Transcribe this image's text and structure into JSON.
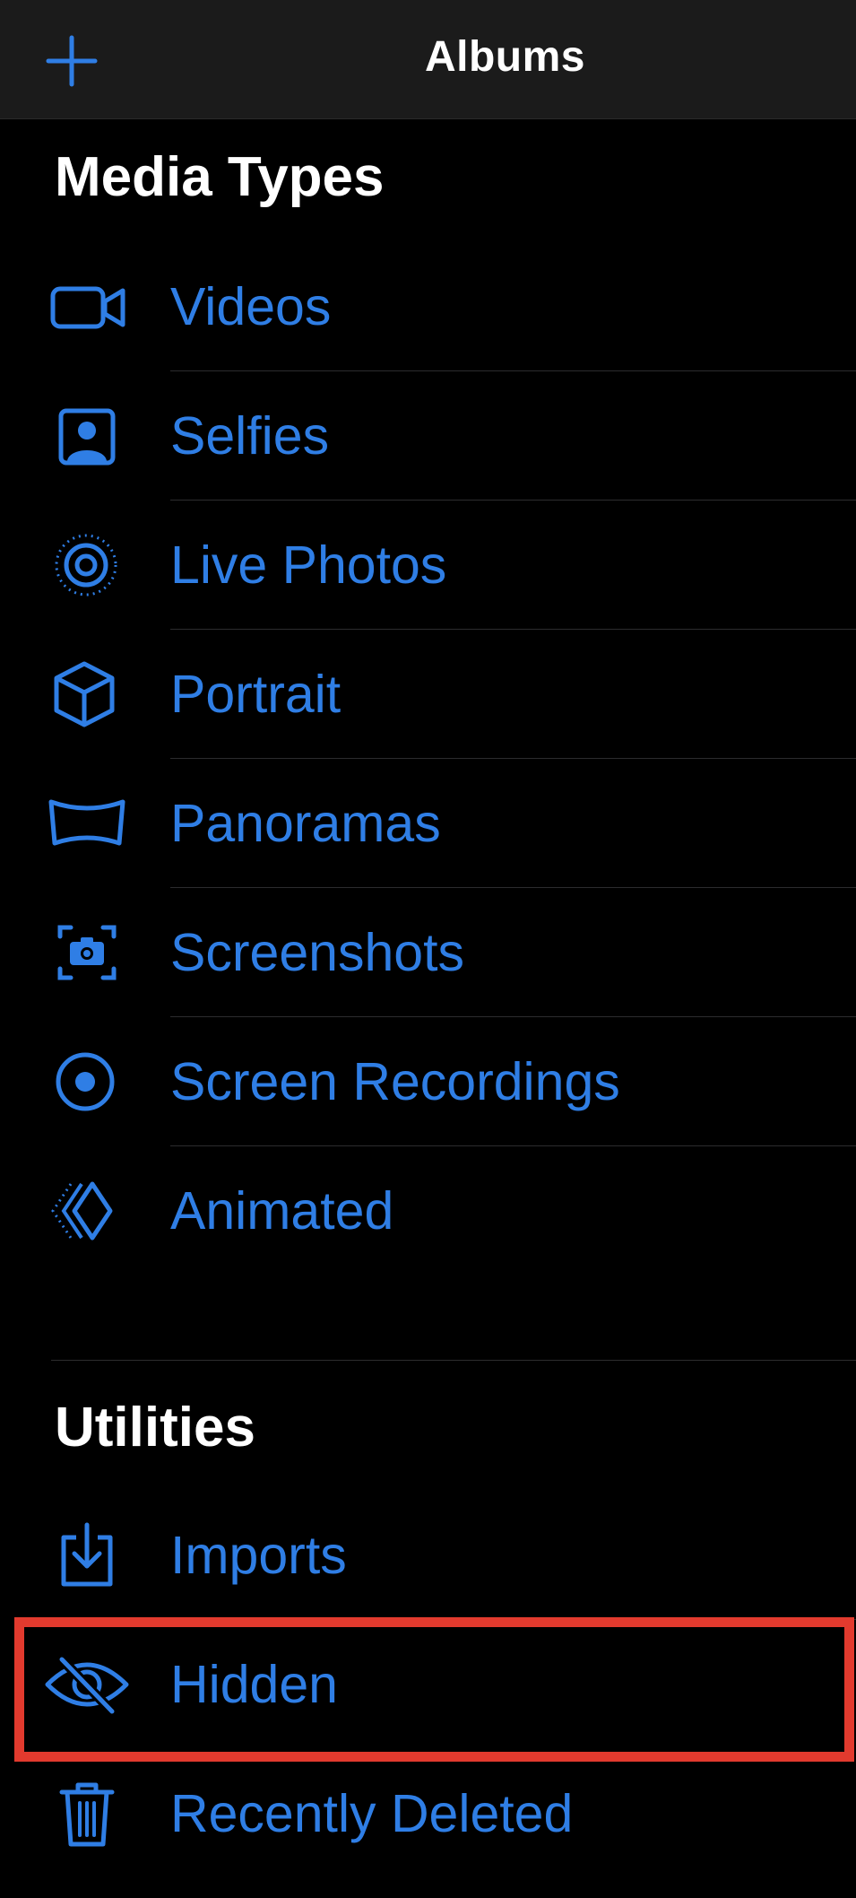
{
  "navbar": {
    "title": "Albums",
    "add_icon": "plus-icon"
  },
  "accent_color": "#2f7ee5",
  "highlight_color": "#e23a2e",
  "media_types": {
    "title": "Media Types",
    "items": [
      {
        "label": "Videos",
        "icon": "video-camera-icon"
      },
      {
        "label": "Selfies",
        "icon": "selfie-portrait-icon"
      },
      {
        "label": "Live Photos",
        "icon": "live-photo-icon"
      },
      {
        "label": "Portrait",
        "icon": "cube-icon"
      },
      {
        "label": "Panoramas",
        "icon": "panorama-icon"
      },
      {
        "label": "Screenshots",
        "icon": "screenshot-camera-icon"
      },
      {
        "label": "Screen Recordings",
        "icon": "record-circle-icon"
      },
      {
        "label": "Animated",
        "icon": "animated-layers-icon"
      }
    ]
  },
  "utilities": {
    "title": "Utilities",
    "items": [
      {
        "label": "Imports",
        "icon": "import-tray-icon"
      },
      {
        "label": "Hidden",
        "icon": "eye-slash-icon",
        "highlighted": true
      },
      {
        "label": "Recently Deleted",
        "icon": "trash-icon"
      }
    ]
  }
}
